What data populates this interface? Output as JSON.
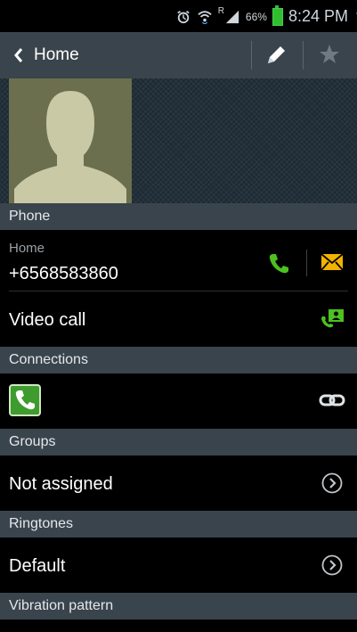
{
  "status_bar": {
    "battery_percent": "66%",
    "time": "8:24 PM",
    "network_badge": "R",
    "icons": [
      "alarm-icon",
      "wifi-icon",
      "signal-icon",
      "battery-icon"
    ]
  },
  "action_bar": {
    "back_label": "Home",
    "icons": [
      "back-chevron-icon",
      "edit-pencil-icon",
      "star-icon"
    ]
  },
  "sections": {
    "phone": "Phone",
    "connections": "Connections",
    "groups": "Groups",
    "ringtones": "Ringtones",
    "vibration": "Vibration pattern"
  },
  "phone_entry": {
    "type_label": "Home",
    "number": "+6568583860"
  },
  "video_call": {
    "label": "Video call"
  },
  "groups": {
    "value": "Not assigned"
  },
  "ringtones": {
    "value": "Default"
  },
  "colors": {
    "section_bg": "#3a444c",
    "call_green": "#4cc11f",
    "message_yellow": "#f2b300"
  }
}
